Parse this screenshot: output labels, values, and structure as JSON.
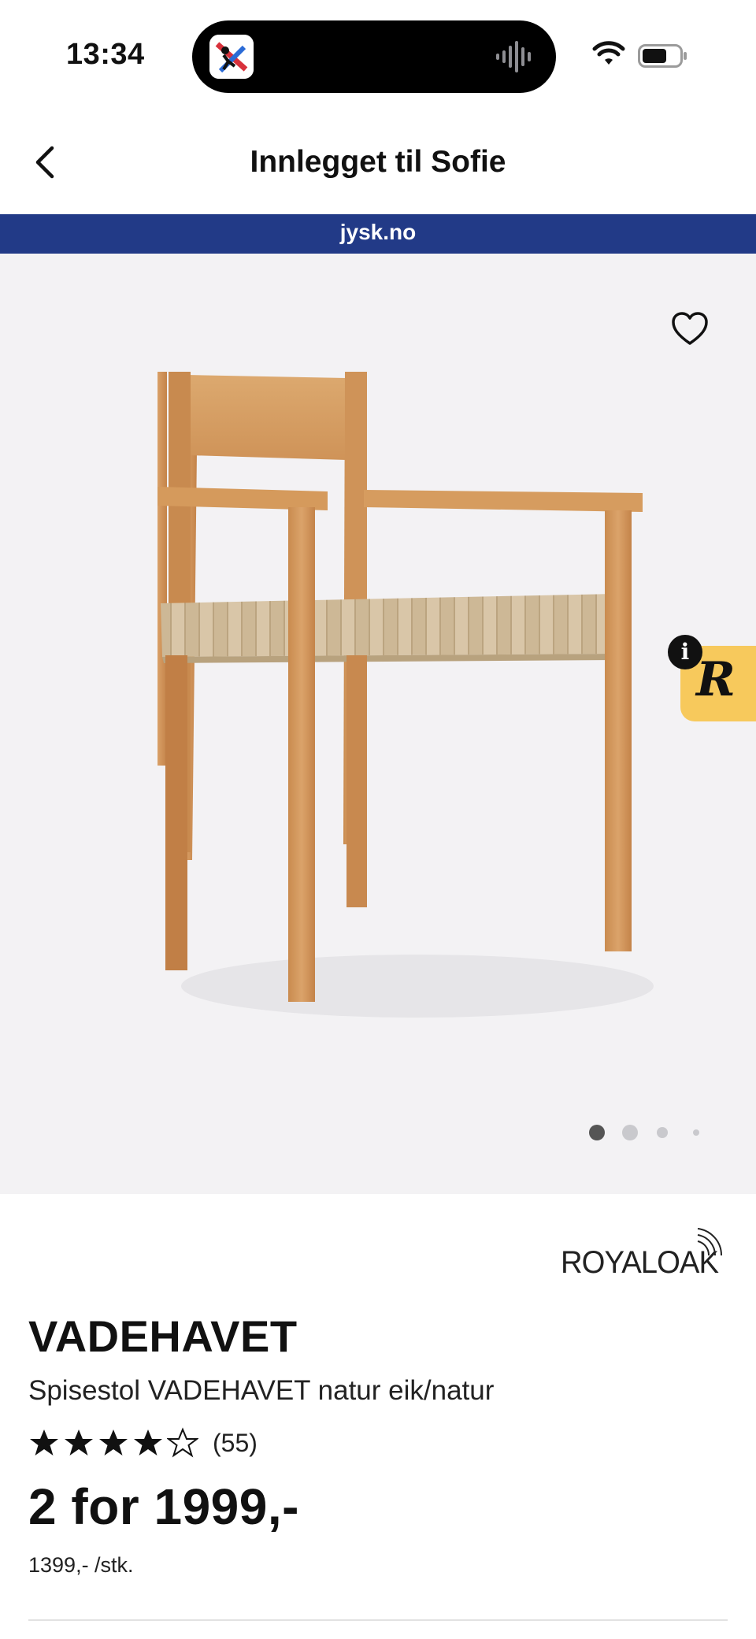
{
  "status_bar": {
    "time": "13:34"
  },
  "nav": {
    "title": "Innlegget til Sofie"
  },
  "banner": {
    "domain": "jysk.no",
    "color": "#223a87"
  },
  "gallery": {
    "total_images": 4,
    "active_index": 0
  },
  "badge": {
    "letter": "R",
    "info": "i",
    "color": "#f7c95c"
  },
  "product": {
    "brand_logo_text": "ROYALOAK",
    "name": "VADEHAVET",
    "description": "Spisestol VADEHAVET natur eik/natur",
    "rating": 4,
    "rating_max": 5,
    "review_count": "(55)",
    "price": "2 for 1999,-",
    "unit_price": "1399,- /stk."
  }
}
